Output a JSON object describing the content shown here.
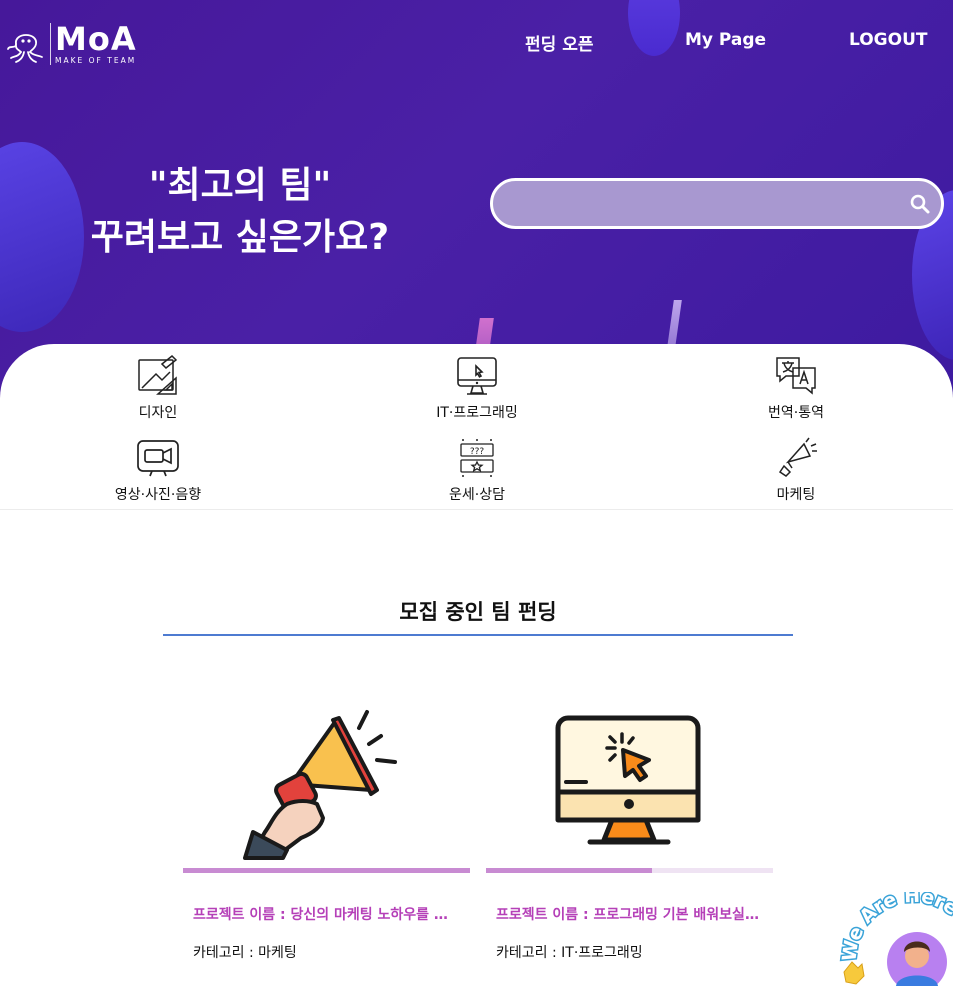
{
  "brand": {
    "name": "MoA",
    "tagline": "MAKE OF TEAM"
  },
  "nav": {
    "items": [
      "펀딩 오픈",
      "My Page",
      "LOGOUT"
    ]
  },
  "hero": {
    "headline_line1": "\"최고의 팀\"",
    "headline_line2": "꾸려보고 싶은가요?",
    "search": {
      "placeholder": "",
      "value": "",
      "icon": "search-icon"
    }
  },
  "categories": [
    {
      "label": "디자인",
      "icon": "design-icon"
    },
    {
      "label": "IT·프로그래밍",
      "icon": "monitor-icon"
    },
    {
      "label": "번역·통역",
      "icon": "translate-icon"
    },
    {
      "label": "영상·사진·음향",
      "icon": "video-icon"
    },
    {
      "label": "운세·상담",
      "icon": "fortune-icon"
    },
    {
      "label": "마케팅",
      "icon": "megaphone-icon"
    }
  ],
  "section": {
    "title": "모집 중인 팀 펀딩"
  },
  "projects": [
    {
      "title": "프로젝트 이름 : 당신의 마케팅 노하우를 …",
      "category": "카테고리 : 마케팅",
      "icon": "megaphone-icon",
      "progress": 1.0
    },
    {
      "title": "프로젝트 이름 : 프로그래밍 기본 배워보실분~",
      "category": "카테고리 : IT·프로그래밍",
      "icon": "monitor-icon",
      "progress": 0.58
    }
  ],
  "floating_badge": {
    "text": "We Are Here"
  },
  "colors": {
    "hero": "#46189a",
    "accent": "#b540b8",
    "progress": "#c88bd2",
    "divider": "#4d7bd1"
  }
}
